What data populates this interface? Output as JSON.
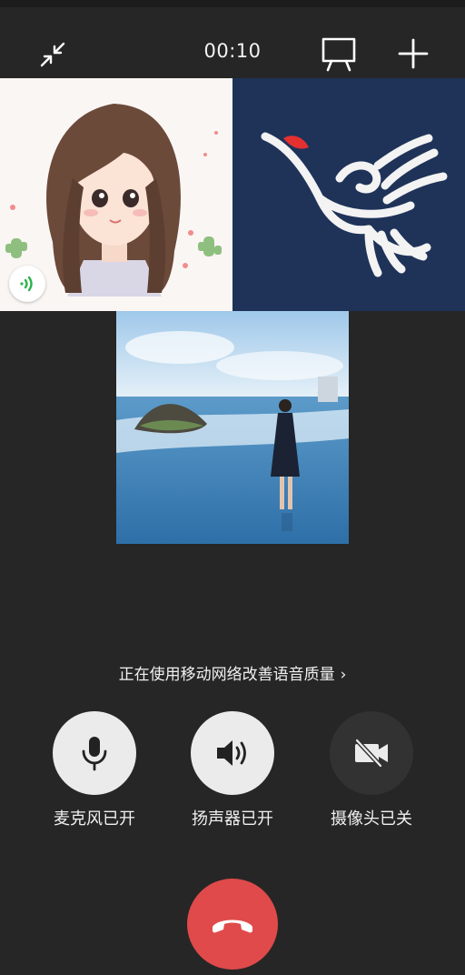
{
  "call": {
    "timer": "00:10",
    "notice": "正在使用移动网络改善语音质量",
    "notice_chevron": "›"
  },
  "icons": {
    "minimize": "collapse-arrows-icon",
    "screen_share": "presentation-screen-icon",
    "add": "plus-icon",
    "speaking": "sound-wave-icon",
    "mic": "microphone-icon",
    "speaker": "speaker-icon",
    "camera": "camera-off-icon",
    "hangup": "phone-hangup-icon"
  },
  "participants": [
    {
      "id": "participant-1",
      "avatar": "cartoon-girl-avatar",
      "speaking": true
    },
    {
      "id": "participant-2",
      "avatar": "red-crowned-crane-logo",
      "speaking": false
    },
    {
      "id": "participant-3",
      "avatar": "beach-photo-avatar",
      "speaking": false
    }
  ],
  "controls": {
    "mic_label": "麦克风已开",
    "speaker_label": "扬声器已开",
    "camera_label": "摄像头已关",
    "mic_on": true,
    "speaker_on": true,
    "camera_on": false
  },
  "colors": {
    "background": "#262626",
    "hangup": "#e04a4a",
    "control_on": "#ebebeb",
    "control_off": "#323232",
    "speaking_green": "#2bb24c"
  }
}
